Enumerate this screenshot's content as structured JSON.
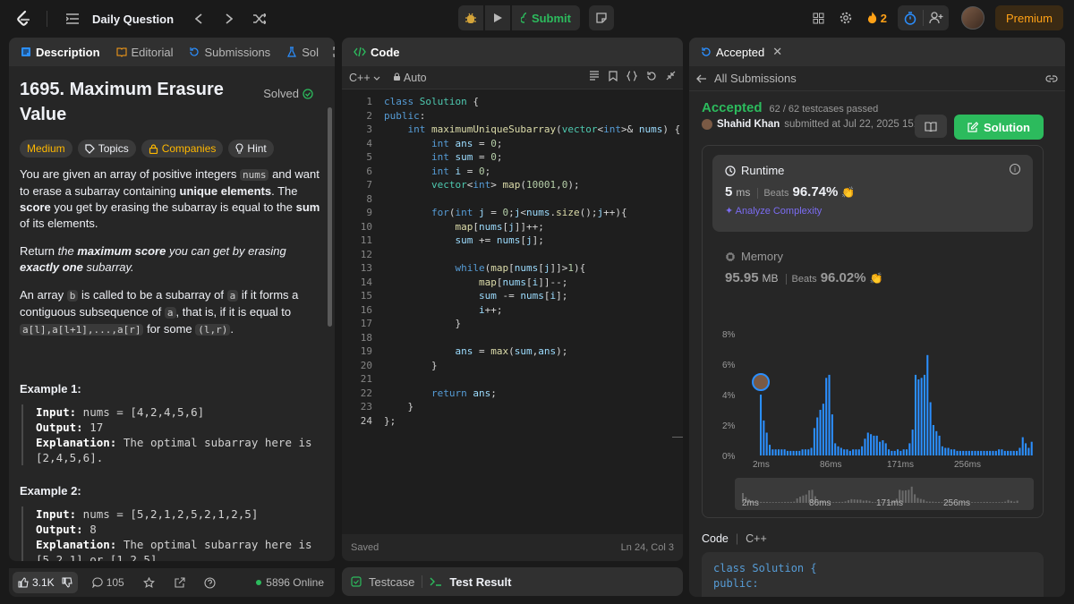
{
  "topbar": {
    "title": "Daily Question",
    "submit": "Submit",
    "streak": "2",
    "premium": "Premium"
  },
  "left": {
    "tabs": [
      "Description",
      "Editorial",
      "Submissions",
      "Sol"
    ],
    "title": "1695. Maximum Erasure Value",
    "solved": "Solved",
    "tags": [
      "Medium",
      "Topics",
      "Companies",
      "Hint"
    ],
    "p1a": "You are given an array of positive integers ",
    "p1code": "nums",
    "p1b": " and want to erase a subarray containing ",
    "p1c": "unique elements",
    "p1d": ". The ",
    "p1e": "score",
    "p1f": " you get by erasing the subarray is equal to the ",
    "p1g": "sum",
    "p1h": " of its elements.",
    "p2a": "Return ",
    "p2b": "the ",
    "p2c": "maximum score",
    "p2d": " you can get by erasing ",
    "p2e": "exactly one",
    "p2f": " subarray.",
    "p3a": "An array ",
    "p3b": "b",
    "p3c": " is called to be a subarray of ",
    "p3d": "a",
    "p3e": " if it forms a contiguous subsequence of ",
    "p3f": "a",
    "p3g": ", that is, if it is equal to ",
    "p3h": "a[l],a[l+1],...,a[r]",
    "p3i": " for some ",
    "p3j": "(l,r)",
    "p3k": ".",
    "ex1": {
      "h": "Example 1:",
      "input_l": "Input:",
      "input": " nums = [4,2,4,5,6]",
      "output_l": "Output:",
      "output": " 17",
      "expl_l": "Explanation:",
      "expl": " The optimal subarray here is [2,4,5,6]."
    },
    "ex2": {
      "h": "Example 2:",
      "input_l": "Input:",
      "input": " nums = [5,2,1,2,5,2,1,2,5]",
      "output_l": "Output:",
      "output": " 8",
      "expl_l": "Explanation:",
      "expl": " The optimal subarray here is [5,2,1] or [1,2,5]."
    },
    "likes": "3.1K",
    "comments": "105",
    "online": "5896 Online"
  },
  "code": {
    "tab": "Code",
    "lang": "C++",
    "mode": "Auto",
    "status": "Saved",
    "pos": "Ln 24, Col 3",
    "lines": [
      "class Solution {",
      "public:",
      "    int maximumUniqueSubarray(vector<int>& nums) {",
      "        int ans = 0;",
      "        int sum = 0;",
      "        int i = 0;",
      "        vector<int> map(10001,0);",
      "",
      "        for(int j = 0;j<nums.size();j++){",
      "            map[nums[j]]++;",
      "            sum += nums[j];",
      "",
      "            while(map[nums[j]]>1){",
      "                map[nums[i]]--;",
      "                sum -= nums[i];",
      "                i++;",
      "            }",
      "",
      "            ans = max(sum,ans);",
      "        }",
      "",
      "        return ans;",
      "    }",
      "};"
    ]
  },
  "tests": {
    "testcase": "Testcase",
    "result": "Test Result"
  },
  "right": {
    "tab": "Accepted",
    "allsub": "All Submissions",
    "status": "Accepted",
    "passed": "62 / 62 testcases passed",
    "user": "Shahid Khan",
    "submitted": "submitted at Jul 22, 2025 15:01",
    "solution": "Solution",
    "runtime": {
      "label": "Runtime",
      "value": "5",
      "unit": "ms",
      "beats_l": "Beats",
      "beats": "96.74%",
      "analyze": "Analyze Complexity"
    },
    "memory": {
      "label": "Memory",
      "value": "95.95",
      "unit": "MB",
      "beats_l": "Beats",
      "beats": "96.02%"
    },
    "code_h": "Code",
    "code_lang": "C++",
    "preview": [
      "class Solution {",
      "public:"
    ]
  },
  "chart_data": {
    "type": "bar",
    "ylabels": [
      "8%",
      "6%",
      "4%",
      "2%",
      "0%"
    ],
    "ylim": [
      0,
      8
    ],
    "xlabels": [
      "2ms",
      "86ms",
      "171ms",
      "256ms"
    ],
    "values": [
      4,
      2.3,
      1.5,
      0.7,
      0.4,
      0.4,
      0.4,
      0.4,
      0.4,
      0.3,
      0.3,
      0.3,
      0.3,
      0.3,
      0.4,
      0.4,
      0.4,
      0.5,
      1.8,
      2.5,
      3,
      3.4,
      5.1,
      5.3,
      2.7,
      0.8,
      0.6,
      0.5,
      0.4,
      0.4,
      0.3,
      0.4,
      0.4,
      0.4,
      0.6,
      1.1,
      1.5,
      1.4,
      1.3,
      1.3,
      0.9,
      1,
      0.8,
      0.4,
      0.3,
      0.3,
      0.4,
      0.3,
      0.4,
      0.4,
      0.8,
      1.7,
      5.3,
      5,
      5.1,
      5.3,
      6.6,
      3.5,
      2,
      1.6,
      1.3,
      0.6,
      0.5,
      0.5,
      0.4,
      0.4,
      0.3,
      0.3,
      0.3,
      0.3,
      0.3,
      0.3,
      0.3,
      0.3,
      0.3,
      0.3,
      0.3,
      0.3,
      0.3,
      0.3,
      0.4,
      0.4,
      0.3,
      0.3,
      0.3,
      0.3,
      0.3,
      0.5,
      1.2,
      0.8,
      0.5,
      0.9
    ],
    "marker_index": 0
  }
}
